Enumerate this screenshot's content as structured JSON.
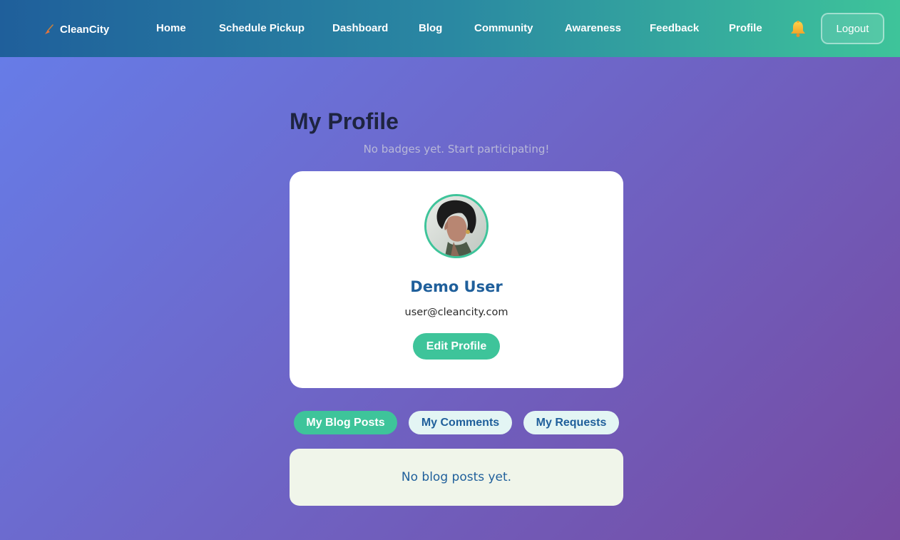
{
  "nav": {
    "brand": "CleanCity",
    "links": [
      "Home",
      "Schedule Pickup",
      "Dashboard",
      "Blog",
      "Community",
      "Awareness",
      "Feedback",
      "Profile"
    ],
    "logout_label": "Logout",
    "bell_icon": "bell-icon",
    "brand_icon": "broom-icon"
  },
  "page": {
    "title": "My Profile",
    "badges_message": "No badges yet. Start participating!"
  },
  "profile": {
    "name": "Demo User",
    "email": "user@cleancity.com",
    "edit_label": "Edit Profile",
    "avatar_icon": "user-avatar"
  },
  "tabs": [
    {
      "label": "My Blog Posts",
      "active": true
    },
    {
      "label": "My Comments",
      "active": false
    },
    {
      "label": "My Requests",
      "active": false
    }
  ],
  "content": {
    "empty_message": "No blog posts yet."
  },
  "colors": {
    "accent": "#3ec49a",
    "primary": "#1f5f9b",
    "gradient_start": "#667eea",
    "gradient_end": "#764ba2"
  }
}
